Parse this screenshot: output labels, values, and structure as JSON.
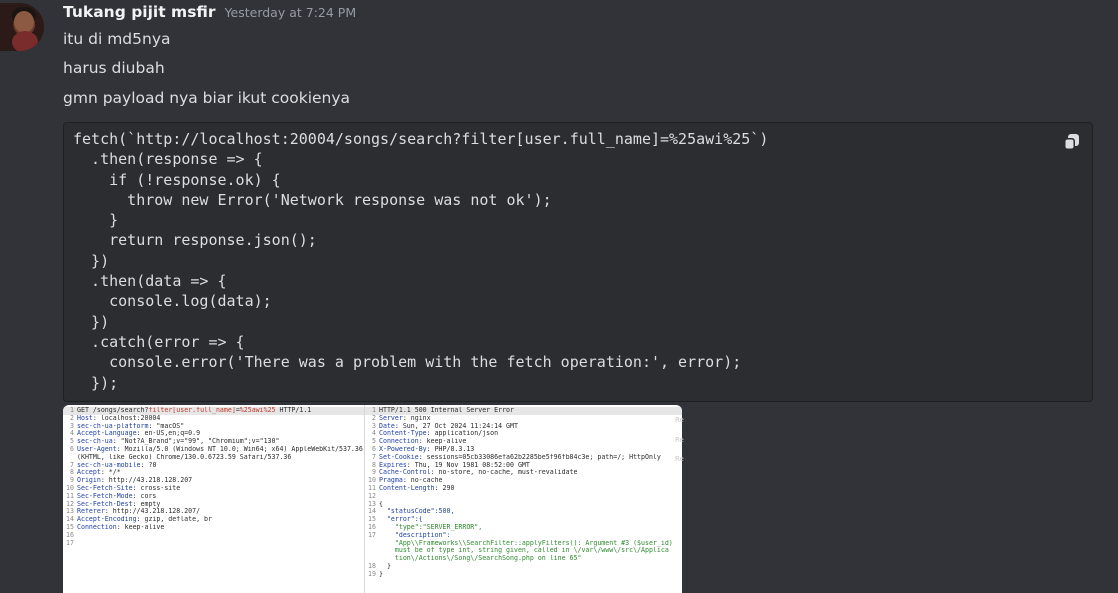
{
  "message": {
    "author": "Tukang pijit msfir",
    "timestamp": "Yesterday at 7:24 PM",
    "lines": [
      "itu di md5nya",
      "harus diubah",
      "gmn payload nya biar ikut cookienya"
    ],
    "code": "fetch(`http://localhost:20004/songs/search?filter[user.full_name]=%25awi%25`)\n  .then(response => {\n    if (!response.ok) {\n      throw new Error('Network response was not ok');\n    }\n    return response.json();\n  })\n  .then(data => {\n    console.log(data);\n  })\n  .catch(error => {\n    console.error('There was a problem with the fetch operation:', error);\n  });"
  },
  "icons": {
    "copy": "copy-icon",
    "avatar": "avatar"
  },
  "request_lines": [
    "GET /songs/search?filter[user.full_name]=%25awi%25 HTTP/1.1",
    "Host: localhost:20004",
    "sec-ch-ua-platform: \"macOS\"",
    "Accept-Language: en-US,en;q=0.9",
    "sec-ch-ua: \"Not?A_Brand\";v=\"99\", \"Chromium\";v=\"130\"",
    "User-Agent: Mozilla/5.0 (Windows NT 10.0; Win64; x64) AppleWebKit/537.36",
    "(KHTML, like Gecko) Chrome/130.0.6723.59 Safari/537.36",
    "sec-ch-ua-mobile: ?0",
    "Accept: */*",
    "Origin: http://43.218.128.207",
    "Sec-Fetch-Site: cross-site",
    "Sec-Fetch-Mode: cors",
    "Sec-Fetch-Dest: empty",
    "Referer: http://43.218.128.207/",
    "Accept-Encoding: gzip, deflate, br",
    "Connection: keep-alive",
    "",
    ""
  ],
  "request_numbers": [
    "1",
    "2",
    "3",
    "4",
    "5",
    "6",
    "",
    "7",
    "8",
    "9",
    "10",
    "11",
    "12",
    "13",
    "14",
    "15",
    "16",
    "17"
  ],
  "response_lines": [
    "HTTP/1.1 500 Internal Server Error",
    "Server: nginx",
    "Date: Sun, 27 Oct 2024 11:24:14 GMT",
    "Content-Type: application/json",
    "Connection: keep-alive",
    "X-Powered-By: PHP/8.3.13",
    "Set-Cookie: sessions=05cb33086efa62b2285be5f96fb84c3e; path=/; HttpOnly",
    "Expires: Thu, 19 Nov 1981 08:52:00 GMT",
    "Cache-Control: no-store, no-cache, must-revalidate",
    "Pragma: no-cache",
    "Content-Length: 290",
    "",
    "{",
    "  \"statusCode\":500,",
    "  \"error\":{",
    "    \"type\":\"SERVER_ERROR\",",
    "    \"description\":",
    "    \"App\\\\Frameworks\\\\SearchFilter::applyFilters(): Argument #3 ($user_id)",
    "    must be of type int, string given, called in \\/var\\/www\\/src\\/Applica",
    "    tion\\/Actions\\/Song\\/SearchSong.php on line 65\"",
    "  }",
    "}"
  ],
  "response_numbers": [
    "1",
    "2",
    "3",
    "4",
    "5",
    "6",
    "7",
    "8",
    "9",
    "10",
    "11",
    "12",
    "13",
    "14",
    "15",
    "16",
    "17",
    "",
    "",
    "",
    "18",
    "19"
  ],
  "side_labels": [
    "Re",
    "Re",
    "Re"
  ],
  "colors": {
    "background": "#313338",
    "code_bg": "#2b2d31",
    "username": "#f2f3f5",
    "timestamp": "#949ba4"
  }
}
